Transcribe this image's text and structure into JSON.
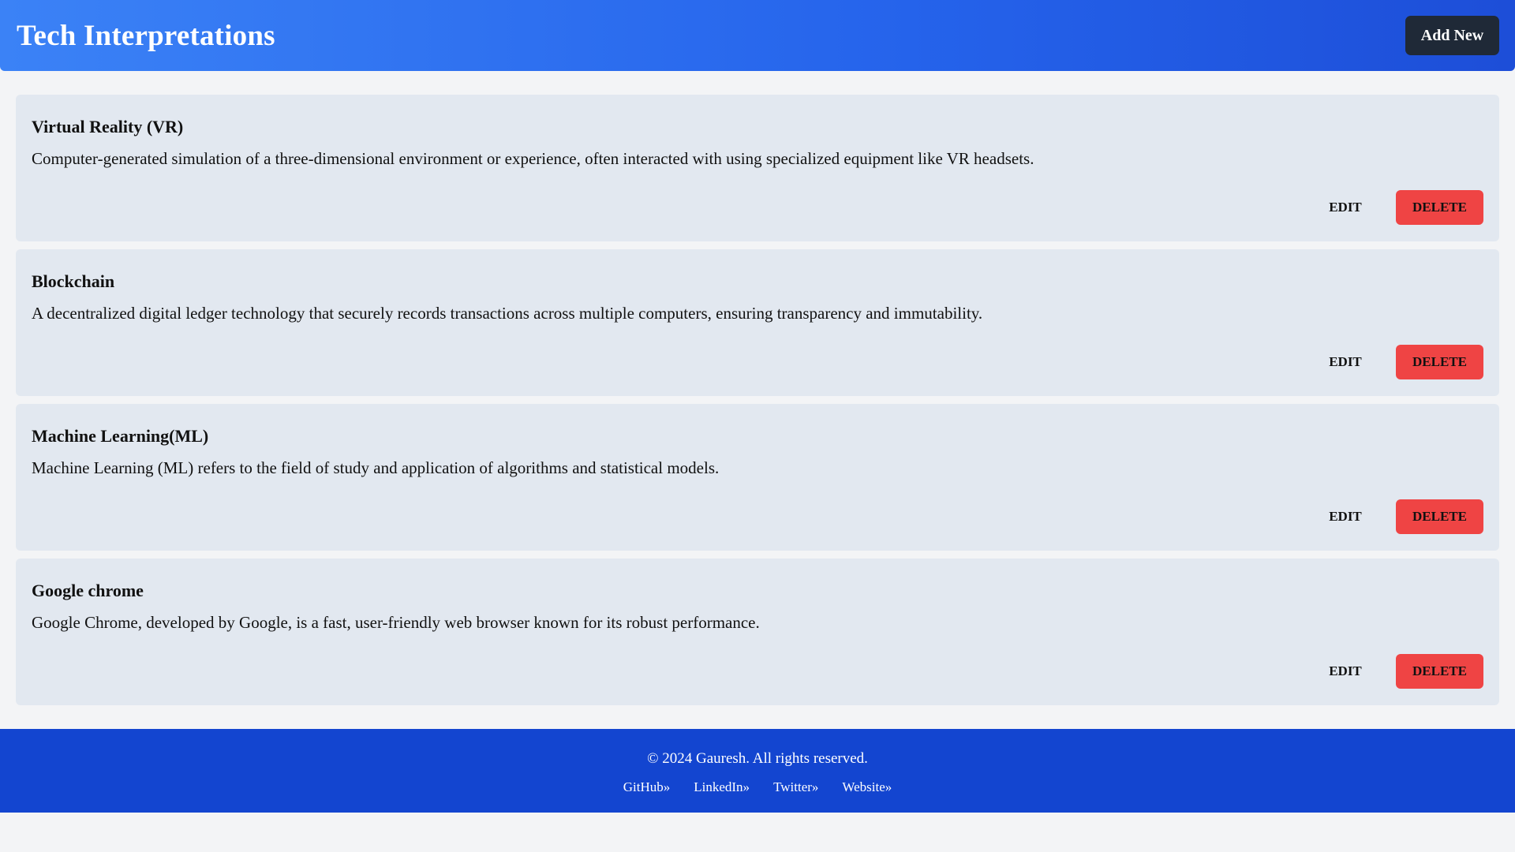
{
  "header": {
    "title": "Tech Interpretations",
    "add_new_label": "Add New"
  },
  "cards": [
    {
      "title": "Virtual Reality (VR)",
      "description": "Computer-generated simulation of a three-dimensional environment or experience, often interacted with using specialized equipment like VR headsets.",
      "edit_label": "EDIT",
      "delete_label": "DELETE"
    },
    {
      "title": "Blockchain",
      "description": "A decentralized digital ledger technology that securely records transactions across multiple computers, ensuring transparency and immutability.",
      "edit_label": "EDIT",
      "delete_label": "DELETE"
    },
    {
      "title": "Machine Learning(ML)",
      "description": "Machine Learning (ML) refers to the field of study and application of algorithms and statistical models.",
      "edit_label": "EDIT",
      "delete_label": "DELETE"
    },
    {
      "title": "Google chrome",
      "description": "Google Chrome, developed by Google, is a fast, user-friendly web browser known for its robust performance.",
      "edit_label": "EDIT",
      "delete_label": "DELETE"
    }
  ],
  "footer": {
    "copyright": "© 2024 Gauresh. All rights reserved.",
    "links": [
      "GitHub»",
      "LinkedIn»",
      "Twitter»",
      "Website»"
    ]
  },
  "colors": {
    "header_gradient_start": "#3b82f6",
    "header_gradient_end": "#1d4ed8",
    "add_button_bg": "#1f2937",
    "card_bg": "#e2e8f0",
    "delete_bg": "#ef4444",
    "footer_bg": "#1345d0",
    "page_bg": "#f3f4f6"
  }
}
